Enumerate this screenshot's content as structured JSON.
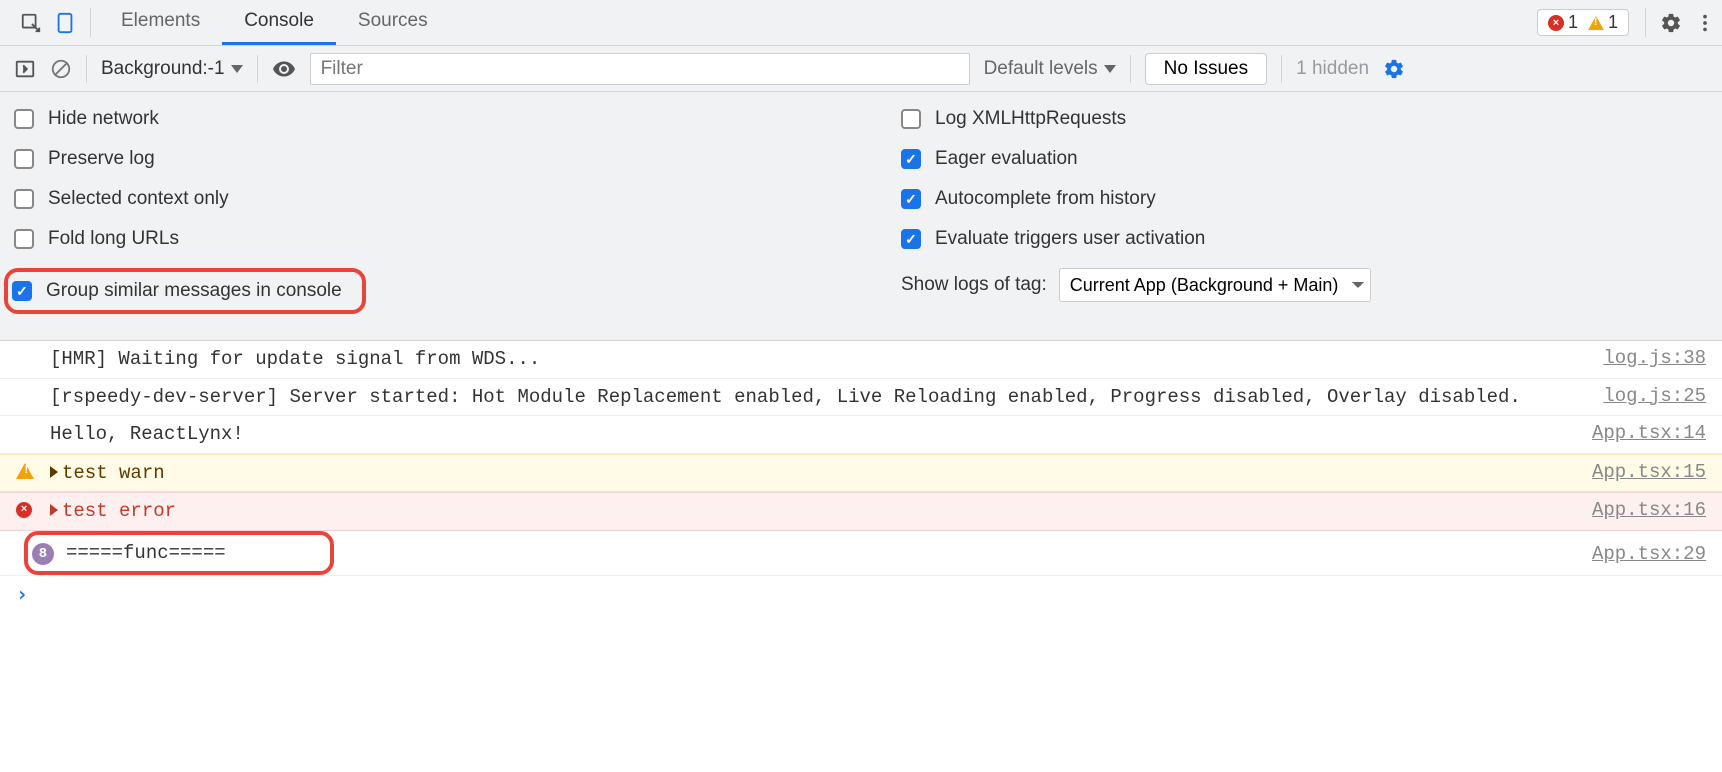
{
  "tabs": {
    "elements": "Elements",
    "console": "Console",
    "sources": "Sources"
  },
  "status_pill": {
    "error_count": "1",
    "warning_count": "1"
  },
  "toolbar": {
    "context_label": "Background:-1",
    "filter_placeholder": "Filter",
    "levels_label": "Default levels",
    "issues_label": "No Issues",
    "hidden_label": "1 hidden"
  },
  "settings": {
    "left": {
      "hide_network": "Hide network",
      "preserve_log": "Preserve log",
      "selected_context_only": "Selected context only",
      "fold_long_urls": "Fold long URLs",
      "group_similar": "Group similar messages in console"
    },
    "right": {
      "log_xhr": "Log XMLHttpRequests",
      "eager_eval": "Eager evaluation",
      "autocomplete_history": "Autocomplete from history",
      "evaluate_triggers": "Evaluate triggers user activation",
      "show_logs_label": "Show logs of tag:",
      "tag_select_value": "Current App (Background + Main)"
    }
  },
  "checks": {
    "hide_network": false,
    "preserve_log": false,
    "selected_context_only": false,
    "fold_long_urls": false,
    "group_similar": true,
    "log_xhr": false,
    "eager_eval": true,
    "autocomplete_history": true,
    "evaluate_triggers": true
  },
  "logs": [
    {
      "type": "log",
      "msg": "[HMR] Waiting for update signal from WDS...",
      "src": "log.js:38"
    },
    {
      "type": "log",
      "msg": "[rspeedy-dev-server] Server started: Hot Module Replacement enabled, Live Reloading enabled, Progress disabled, Overlay disabled.",
      "src": "log.js:25"
    },
    {
      "type": "log",
      "msg": "Hello, ReactLynx!",
      "src": "App.tsx:14"
    },
    {
      "type": "warn",
      "msg": "test warn",
      "src": "App.tsx:15"
    },
    {
      "type": "error",
      "msg": "test error",
      "src": "App.tsx:16"
    },
    {
      "type": "count",
      "count": "8",
      "msg": "=====func=====",
      "src": "App.tsx:29",
      "highlighted": true
    }
  ]
}
